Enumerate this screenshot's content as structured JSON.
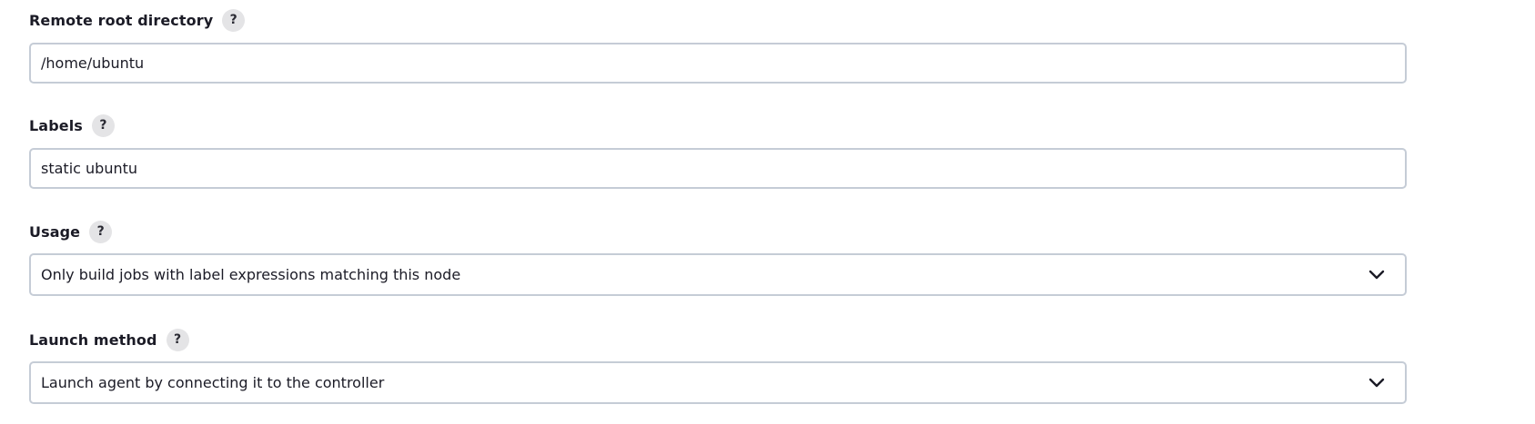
{
  "fields": {
    "remote_root": {
      "label": "Remote root directory",
      "help": "?",
      "value": "/home/ubuntu"
    },
    "labels": {
      "label": "Labels",
      "help": "?",
      "value": "static ubuntu"
    },
    "usage": {
      "label": "Usage",
      "help": "?",
      "selected": "Only build jobs with label expressions matching this node",
      "icon": "chevron-down-icon"
    },
    "launch_method": {
      "label": "Launch method",
      "help": "?",
      "selected": "Launch agent by connecting it to the controller",
      "icon": "chevron-down-icon"
    }
  },
  "colors": {
    "border": "#c5ccd6",
    "help_bg": "#e4e4e6",
    "text": "#1b1b26"
  }
}
